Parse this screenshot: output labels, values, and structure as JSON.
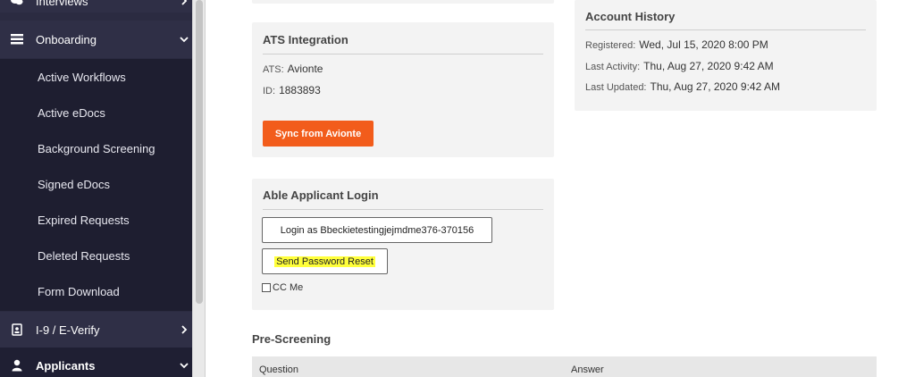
{
  "sidebar": {
    "interviews": {
      "label": "Interviews"
    },
    "onboarding": {
      "label": "Onboarding"
    },
    "onboarding_items": [
      {
        "label": "Active Workflows"
      },
      {
        "label": "Active eDocs"
      },
      {
        "label": "Background Screening"
      },
      {
        "label": "Signed eDocs"
      },
      {
        "label": "Expired Requests"
      },
      {
        "label": "Deleted Requests"
      },
      {
        "label": "Form Download"
      }
    ],
    "i9": {
      "label": "I-9 / E-Verify"
    },
    "applicants": {
      "label": "Applicants"
    }
  },
  "ats_integration": {
    "title": "ATS Integration",
    "ats_key": "ATS:",
    "ats_value": "Avionte",
    "id_key": "ID:",
    "id_value": "1883893",
    "sync_button": "Sync from Avionte"
  },
  "account_history": {
    "title": "Account History",
    "registered_key": "Registered:",
    "registered_value": "Wed, Jul 15, 2020 8:00 PM",
    "last_activity_key": "Last Activity:",
    "last_activity_value": "Thu, Aug 27, 2020 9:42 AM",
    "last_updated_key": "Last Updated:",
    "last_updated_value": "Thu, Aug 27, 2020 9:42 AM"
  },
  "able_login": {
    "title": "Able Applicant Login",
    "login_button": "Login as Bbeckietestingjejmdme376-370156",
    "reset_button": "Send Password Reset",
    "cc_me": "CC Me"
  },
  "pre_screening": {
    "title": "Pre-Screening",
    "col_question": "Question",
    "col_answer": "Answer"
  },
  "colors": {
    "sidebar_bg": "#2b2b41",
    "accent_orange": "#f25c1b",
    "highlight_yellow": "#ffff3a"
  }
}
